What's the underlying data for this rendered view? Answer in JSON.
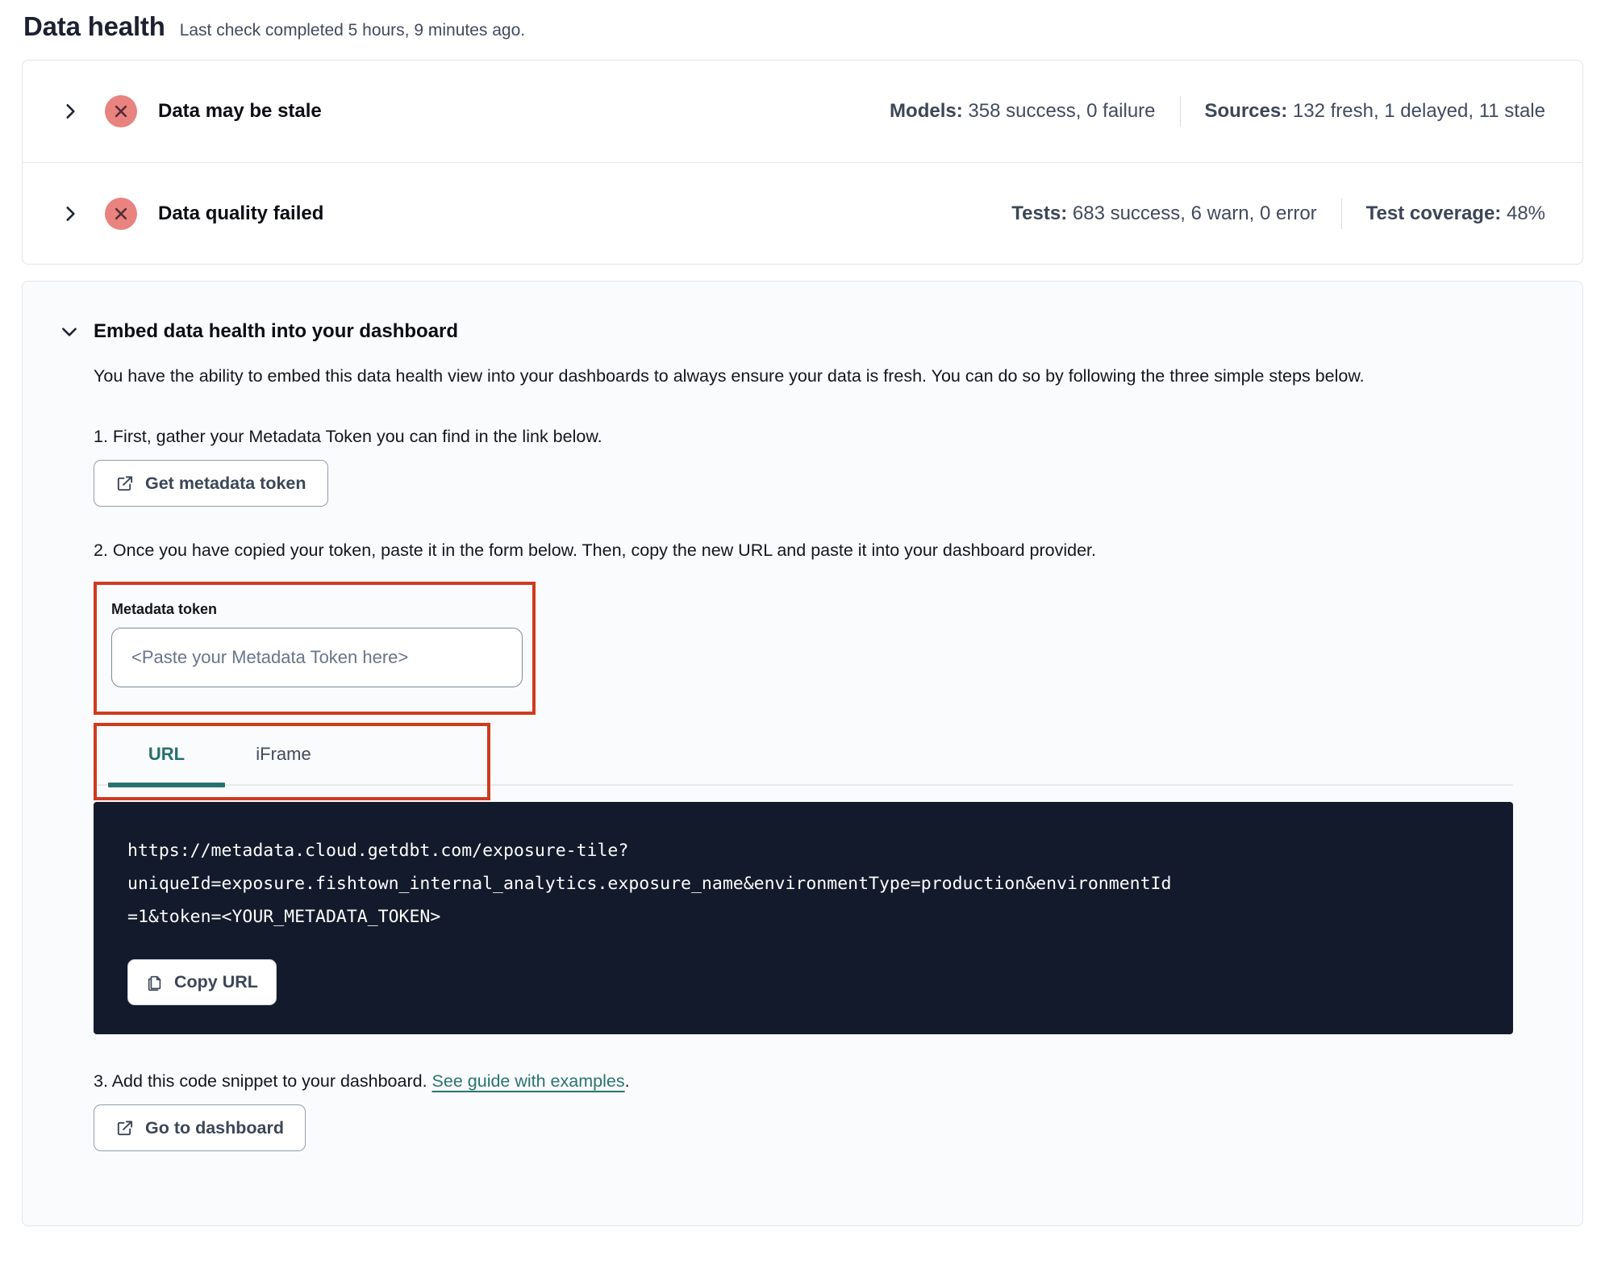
{
  "page": {
    "title": "Data health",
    "subtitle": "Last check completed 5 hours, 9 minutes ago."
  },
  "status_rows": [
    {
      "label": "Data may be stale",
      "status_icon": "x-circle",
      "metric1_label": "Models:",
      "metric1_value": " 358 success, 0 failure",
      "metric2_label": "Sources:",
      "metric2_value": " 132 fresh, 1 delayed, 11 stale"
    },
    {
      "label": "Data quality failed",
      "status_icon": "x-circle",
      "metric1_label": "Tests:",
      "metric1_value": " 683 success, 6 warn, 0 error",
      "metric2_label": "Test coverage:",
      "metric2_value": " 48%"
    }
  ],
  "embed": {
    "title": "Embed data health into your dashboard",
    "description": "You have the ability to embed this data health view into your dashboards to always ensure your data is fresh. You can do so by following the three simple steps below.",
    "step1_text": "1. First, gather your Metadata Token you can find in the link below.",
    "get_token_button": "Get metadata token",
    "step2_text": "2. Once you have copied your token, paste it in the form below. Then, copy the new URL and paste it into your dashboard provider.",
    "token_field": {
      "label": "Metadata token",
      "placeholder": "<Paste your Metadata Token here>",
      "value": ""
    },
    "tabs": [
      {
        "label": "URL",
        "active": true
      },
      {
        "label": "iFrame",
        "active": false
      }
    ],
    "code_lines": {
      "line1": "https://metadata.cloud.getdbt.com/exposure-tile?",
      "line2": "uniqueId=exposure.fishtown_internal_analytics.exposure_name&environmentType=production&environmentId",
      "line3": "=1&token=<YOUR_METADATA_TOKEN>"
    },
    "copy_url_button": "Copy URL",
    "step3_text_before": "3. Add this code snippet to your dashboard. ",
    "step3_link": "See guide with examples",
    "step3_text_after": ".",
    "go_dashboard_button": "Go to dashboard"
  },
  "colors": {
    "accent_teal": "#2b7172",
    "annotation_red": "#cf3a1e",
    "status_icon_bg": "#e8837f",
    "status_icon_glyph": "#542b32",
    "code_background": "#131a2b"
  }
}
